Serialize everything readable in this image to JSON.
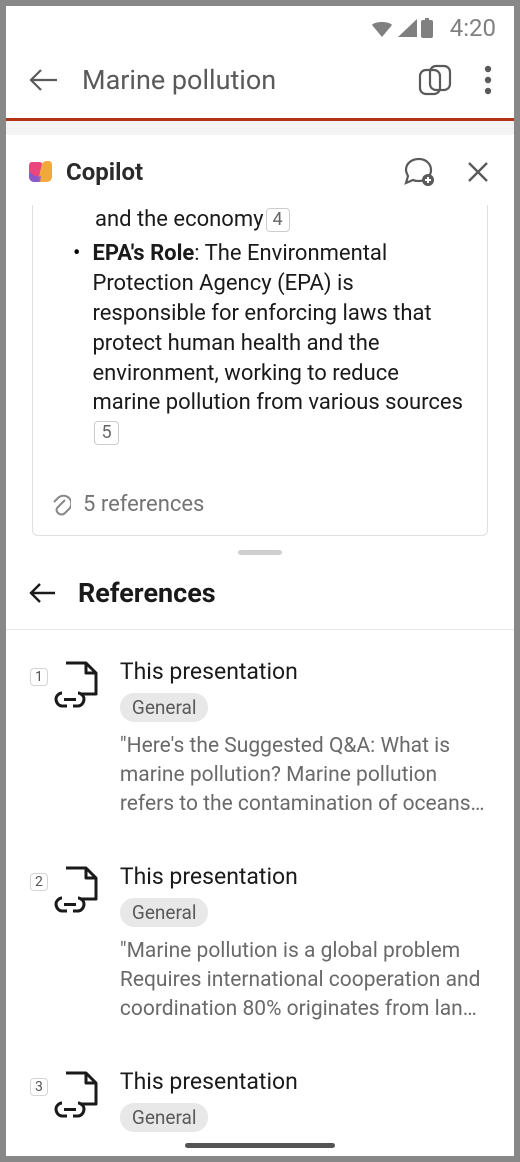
{
  "status": {
    "time": "4:20"
  },
  "header": {
    "title": "Marine pollution"
  },
  "copilot": {
    "title": "Copilot",
    "answer": {
      "truncated_line": "and the economy",
      "truncated_cite": "4",
      "bullet_label": "EPA's Role",
      "bullet_text": ": The Environmental Protection Agency (EPA) is responsible for enforcing laws that protect human health and the environment, working to reduce marine pollution from various sources",
      "bullet_cite": "5"
    },
    "refs_footer": "5 references"
  },
  "references": {
    "title": "References",
    "items": [
      {
        "index": "1",
        "title": "This presentation",
        "tag": "General",
        "snippet": "\"Here's the Suggested Q&A:   What is marine pollution?   Marine pollution refers to the contamination of oceans…"
      },
      {
        "index": "2",
        "title": "This presentation",
        "tag": "General",
        "snippet": "\"Marine pollution is a global problem Requires international cooperation and coordination 80% originates from lan…"
      },
      {
        "index": "3",
        "title": "This presentation",
        "tag": "General",
        "snippet": ""
      }
    ]
  }
}
